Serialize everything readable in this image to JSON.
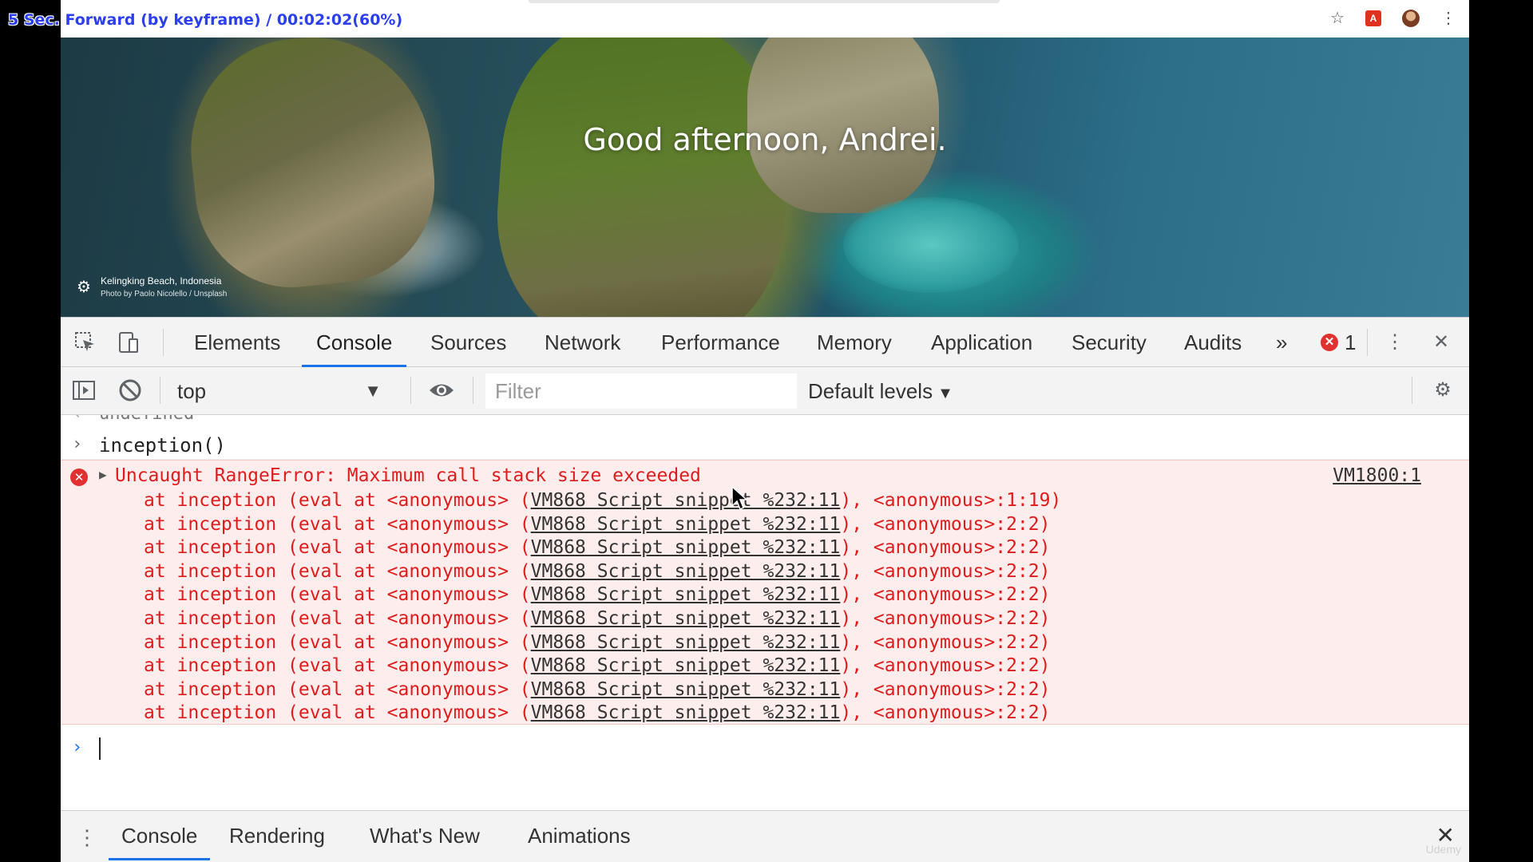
{
  "overlay": {
    "text": "5 Sec. Forward (by keyframe) / 00:02:02(60%)"
  },
  "browser": {
    "toolbar_icons": [
      {
        "name": "star-icon",
        "glyph": "☆"
      },
      {
        "name": "extension-icon",
        "glyph": "A"
      },
      {
        "name": "avatar",
        "glyph": ""
      },
      {
        "name": "more-vert-icon",
        "glyph": "⋮"
      }
    ]
  },
  "hero": {
    "greeting": "Good afternoon, Andrei.",
    "photo_title": "Kelingking Beach, Indonesia",
    "photo_credit": "Photo by Paolo Nicolello / Unsplash"
  },
  "devtools": {
    "tabs": [
      "Elements",
      "Console",
      "Sources",
      "Network",
      "Performance",
      "Memory",
      "Application",
      "Security",
      "Audits"
    ],
    "active_tab": "Console",
    "more_tabs": "»",
    "error_count": "1",
    "context": "top",
    "filter_placeholder": "Filter",
    "levels": "Default levels",
    "console": {
      "previous_output": "undefined",
      "input": "inception()",
      "error": {
        "message": "Uncaught RangeError: Maximum call stack size exceeded",
        "source": "VM1800:1",
        "stack": [
          {
            "prefix": "at inception (eval at <anonymous> (",
            "link": "VM868 Script snippet %232:11",
            "suffix": "), <anonymous>:1:19)"
          },
          {
            "prefix": "at inception (eval at <anonymous> (",
            "link": "VM868 Script snippet %232:11",
            "suffix": "), <anonymous>:2:2)"
          },
          {
            "prefix": "at inception (eval at <anonymous> (",
            "link": "VM868 Script snippet %232:11",
            "suffix": "), <anonymous>:2:2)"
          },
          {
            "prefix": "at inception (eval at <anonymous> (",
            "link": "VM868 Script snippet %232:11",
            "suffix": "), <anonymous>:2:2)"
          },
          {
            "prefix": "at inception (eval at <anonymous> (",
            "link": "VM868 Script snippet %232:11",
            "suffix": "), <anonymous>:2:2)"
          },
          {
            "prefix": "at inception (eval at <anonymous> (",
            "link": "VM868 Script snippet %232:11",
            "suffix": "), <anonymous>:2:2)"
          },
          {
            "prefix": "at inception (eval at <anonymous> (",
            "link": "VM868 Script snippet %232:11",
            "suffix": "), <anonymous>:2:2)"
          },
          {
            "prefix": "at inception (eval at <anonymous> (",
            "link": "VM868 Script snippet %232:11",
            "suffix": "), <anonymous>:2:2)"
          },
          {
            "prefix": "at inception (eval at <anonymous> (",
            "link": "VM868 Script snippet %232:11",
            "suffix": "), <anonymous>:2:2)"
          },
          {
            "prefix": "at inception (eval at <anonymous> (",
            "link": "VM868 Script snippet %232:11",
            "suffix": "), <anonymous>:2:2)"
          }
        ]
      }
    },
    "drawer": {
      "tabs": [
        "Console",
        "Rendering",
        "What's New",
        "Animations"
      ],
      "active_tab": "Console",
      "watermark": "Udemy"
    }
  },
  "colors": {
    "accent": "#1a73e8",
    "error_text": "#e01c1c",
    "error_bg": "#fdeded",
    "toolbar_bg": "#f3f3f3"
  }
}
